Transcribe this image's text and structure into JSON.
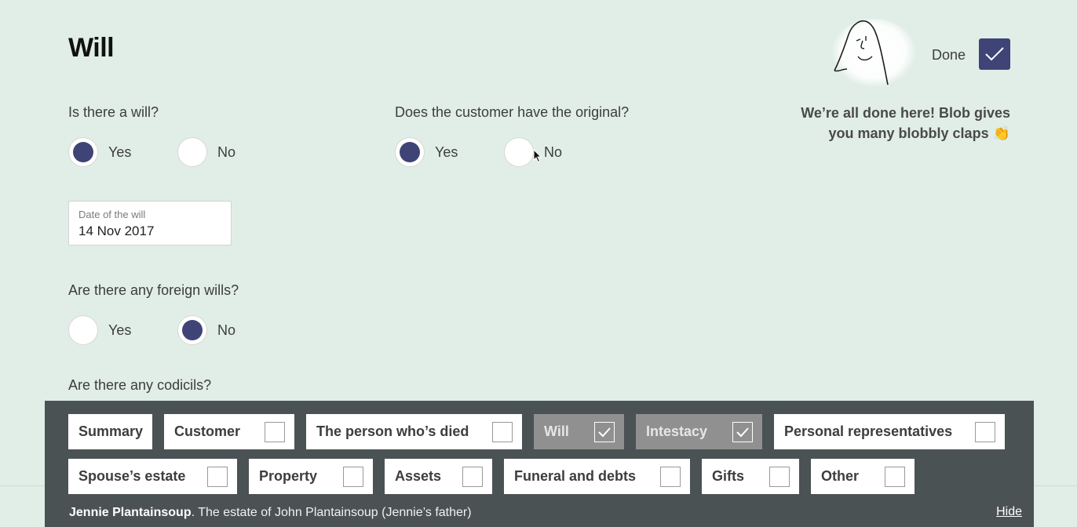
{
  "page": {
    "title": "Will"
  },
  "questions": {
    "is_there_will": {
      "label": "Is there a will?",
      "options": [
        "Yes",
        "No"
      ],
      "selected": "Yes"
    },
    "has_original": {
      "label": "Does the customer have the original?",
      "options": [
        "Yes",
        "No"
      ],
      "selected": "Yes"
    },
    "date_of_will": {
      "label": "Date of the will",
      "value": "14 Nov 2017"
    },
    "foreign_wills": {
      "label": "Are there any foreign wills?",
      "options": [
        "Yes",
        "No"
      ],
      "selected": "No"
    },
    "codicils": {
      "label": "Are there any codicils?"
    }
  },
  "status": {
    "done_label": "Done",
    "done_checked": true,
    "message_line1": "We’re all done here! Blob gives",
    "message_line2": "you many blobbly claps 👏"
  },
  "nav": {
    "tiles": [
      {
        "label": "Summary",
        "has_check": false,
        "checked": false
      },
      {
        "label": "Customer",
        "has_check": true,
        "checked": false
      },
      {
        "label": "The person who’s died",
        "has_check": true,
        "checked": false
      },
      {
        "label": "Will",
        "has_check": true,
        "checked": true
      },
      {
        "label": "Intestacy",
        "has_check": true,
        "checked": true
      },
      {
        "label": "Personal representatives",
        "has_check": true,
        "checked": false
      },
      {
        "label": "Spouse’s estate",
        "has_check": true,
        "checked": false
      },
      {
        "label": "Property",
        "has_check": true,
        "checked": false
      },
      {
        "label": "Assets",
        "has_check": true,
        "checked": false
      },
      {
        "label": "Funeral and debts",
        "has_check": true,
        "checked": false
      },
      {
        "label": "Gifts",
        "has_check": true,
        "checked": false
      },
      {
        "label": "Other",
        "has_check": true,
        "checked": false
      }
    ],
    "estate_name": "Jennie Plantainsoup",
    "estate_desc": ". The estate of John Plantainsoup (Jennie’s father)",
    "hide_label": "Hide"
  },
  "colors": {
    "background": "#e1eee7",
    "accent": "#3e4475",
    "panel": "#4b5254",
    "tile_done": "#909090"
  }
}
